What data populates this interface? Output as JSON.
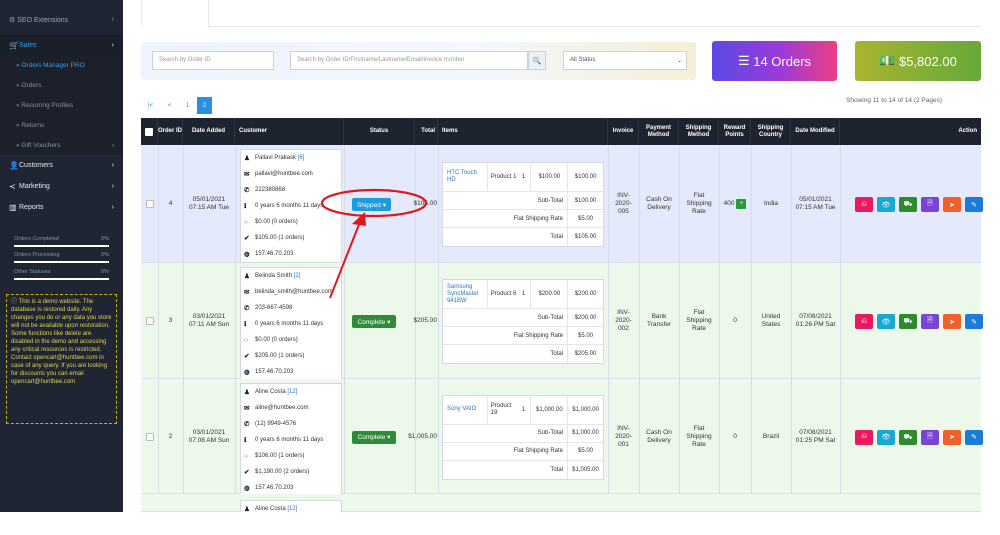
{
  "sidebar": {
    "top_item": "SEO Extensions",
    "sales": "Sales",
    "sub": [
      "Orders Manager PRO",
      "Orders",
      "Recurring Profiles",
      "Returns",
      "Gift Vouchers"
    ],
    "customers": "Customers",
    "marketing": "Marketing",
    "reports": "Reports",
    "progress": [
      {
        "label": "Orders Completed",
        "pct": "0%"
      },
      {
        "label": "Orders Processing",
        "pct": "0%"
      },
      {
        "label": "Other Statuses",
        "pct": "0%"
      }
    ],
    "demo_notice": "This is a demo website. The database is restored daily. Any changes you do or any data you store will not be available upon restoration. Some functions like delete are disabled in the demo and accessing any critical resources is restricted. Contact opencart@huntbee.com in case of any query. If you are looking for discounts you can email opencart@huntbee.com"
  },
  "filters": {
    "order_id_placeholder": "Search by Order ID",
    "general_placeholder": "Search by Order ID/Firstname/Lastname/Email/Invoice number",
    "status_value": "All Status"
  },
  "stats": {
    "orders": "14 Orders",
    "total": "$5,802.00"
  },
  "pagination": {
    "first": "|<",
    "prev": "<",
    "pages": [
      "1",
      "2"
    ],
    "active": "2"
  },
  "showing": "Showing 11 to 14 of 14 (2 Pages)",
  "columns": [
    "Order ID",
    "Date Added",
    "Customer",
    "Status",
    "Total",
    "Items",
    "Invoice",
    "Payment Method",
    "Shipping Method",
    "Reward Points",
    "Shipping Country",
    "Date Modified",
    "Action"
  ],
  "orders": [
    {
      "id": "4",
      "date": "05/01/2021",
      "time": "07:15 AM Tue",
      "name": "Pallavi Prakask",
      "name_count": "[6]",
      "email": "pallavi@huntbee.com",
      "phone": "222380868",
      "age": "0 years 6 months 11 days",
      "zero": "$0.00 (0 orders)",
      "paid": "$105.00 (1 orders)",
      "ip": "157.46.70.203",
      "status": "Shipped ▾",
      "total": "$105.00",
      "product": "HTC Touch HD",
      "model": "Product 1",
      "qty": "1",
      "price": "$100.00",
      "line_total": "$100.00",
      "subtotal_label": "Sub-Total",
      "subtotal": "$100.00",
      "ship_label": "Flat Shipping Rate",
      "ship": "$5.00",
      "total_label": "Total",
      "grand": "$105.00",
      "invoice": "INV-2020-005",
      "payment": "Cash On Delivery",
      "shipping": "Flat Shipping Rate",
      "reward": "400",
      "country": "India",
      "mod_date": "05/01/2021",
      "mod_time": "07:15 AM Tue"
    },
    {
      "id": "3",
      "date": "03/01/2021",
      "time": "07:11 AM Sun",
      "name": "Belinda Smith",
      "name_count": "[2]",
      "email": "belinda_smith@huntbee.com",
      "phone": "203-667-4598",
      "age": "0 years 6 months 11 days",
      "zero": "$0.00 (0 orders)",
      "paid": "$205.00 (1 orders)",
      "ip": "157.46.70.203",
      "status": "Complete ▾",
      "total": "$205.00",
      "product": "Samsung SyncMaster 941BW",
      "model": "Product 6",
      "qty": "1",
      "price": "$200.00",
      "line_total": "$200.00",
      "subtotal_label": "Sub-Total",
      "subtotal": "$200.00",
      "ship_label": "Flat Shipping Rate",
      "ship": "$5.00",
      "total_label": "Total",
      "grand": "$205.00",
      "invoice": "INV-2020-002",
      "payment": "Bank Transfer",
      "shipping": "Flat Shipping Rate",
      "reward": "0",
      "country": "United States",
      "mod_date": "07/08/2021",
      "mod_time": "01:26 PM Sat"
    },
    {
      "id": "2",
      "date": "03/01/2021",
      "time": "07:08 AM Sun",
      "name": "Aline Costa",
      "name_count": "[12]",
      "email": "aline@huntbee.com",
      "phone": "(12) 9949-4576",
      "age": "0 years 6 months 11 days",
      "zero": "$106.00 (1 orders)",
      "paid": "$1,190.00 (2 orders)",
      "ip": "157.46.70.203",
      "status": "Complete ▾",
      "total": "$1,005.00",
      "product": "Sony VAIO",
      "model": "Product 19",
      "qty": "1",
      "price": "$1,000.00",
      "line_total": "$1,000.00",
      "subtotal_label": "Sub-Total",
      "subtotal": "$1,000.00",
      "ship_label": "Flat Shipping Rate",
      "ship": "$5.00",
      "total_label": "Total",
      "grand": "$1,005.00",
      "invoice": "INV-2020-001",
      "payment": "Cash On Delivery",
      "shipping": "Flat Shipping Rate",
      "reward": "0",
      "country": "Brazil",
      "mod_date": "07/08/2021",
      "mod_time": "01:25 PM Sat"
    }
  ],
  "partial_row": {
    "name": "Aline Costa",
    "name_count": "[12]"
  },
  "colors": {
    "shipped": "#1d9ae0",
    "complete": "#2f8a3a",
    "annotation": "#e0181b",
    "row1": "#e4e9fb",
    "row2": "#ecf8ea"
  }
}
